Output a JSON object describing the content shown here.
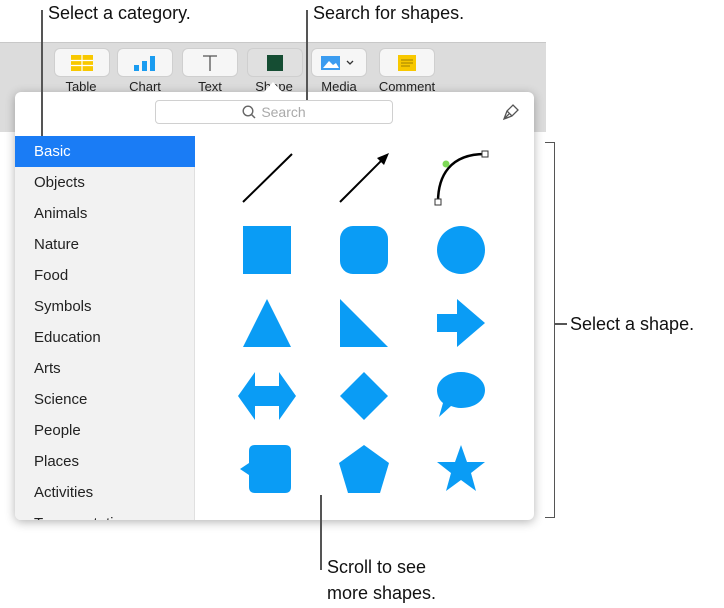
{
  "toolbar": {
    "buttons": [
      {
        "label": "Table",
        "icon": "table-icon"
      },
      {
        "label": "Chart",
        "icon": "chart-icon"
      },
      {
        "label": "Text",
        "icon": "text-icon"
      },
      {
        "label": "Shape",
        "icon": "shape-icon"
      },
      {
        "label": "Media",
        "icon": "media-icon"
      },
      {
        "label": "Comment",
        "icon": "comment-icon"
      }
    ]
  },
  "popover": {
    "search_placeholder": "Search",
    "categories": [
      "Basic",
      "Objects",
      "Animals",
      "Nature",
      "Food",
      "Symbols",
      "Education",
      "Arts",
      "Science",
      "People",
      "Places",
      "Activities",
      "Transportation"
    ],
    "selected_category": "Basic"
  },
  "annotations": {
    "category": "Select a category.",
    "search": "Search for shapes.",
    "shape": "Select a shape.",
    "scroll1": "Scroll to see",
    "scroll2": "more shapes."
  },
  "colors": {
    "accent": "#1a7cf5",
    "shape": "#0a9cf5"
  }
}
